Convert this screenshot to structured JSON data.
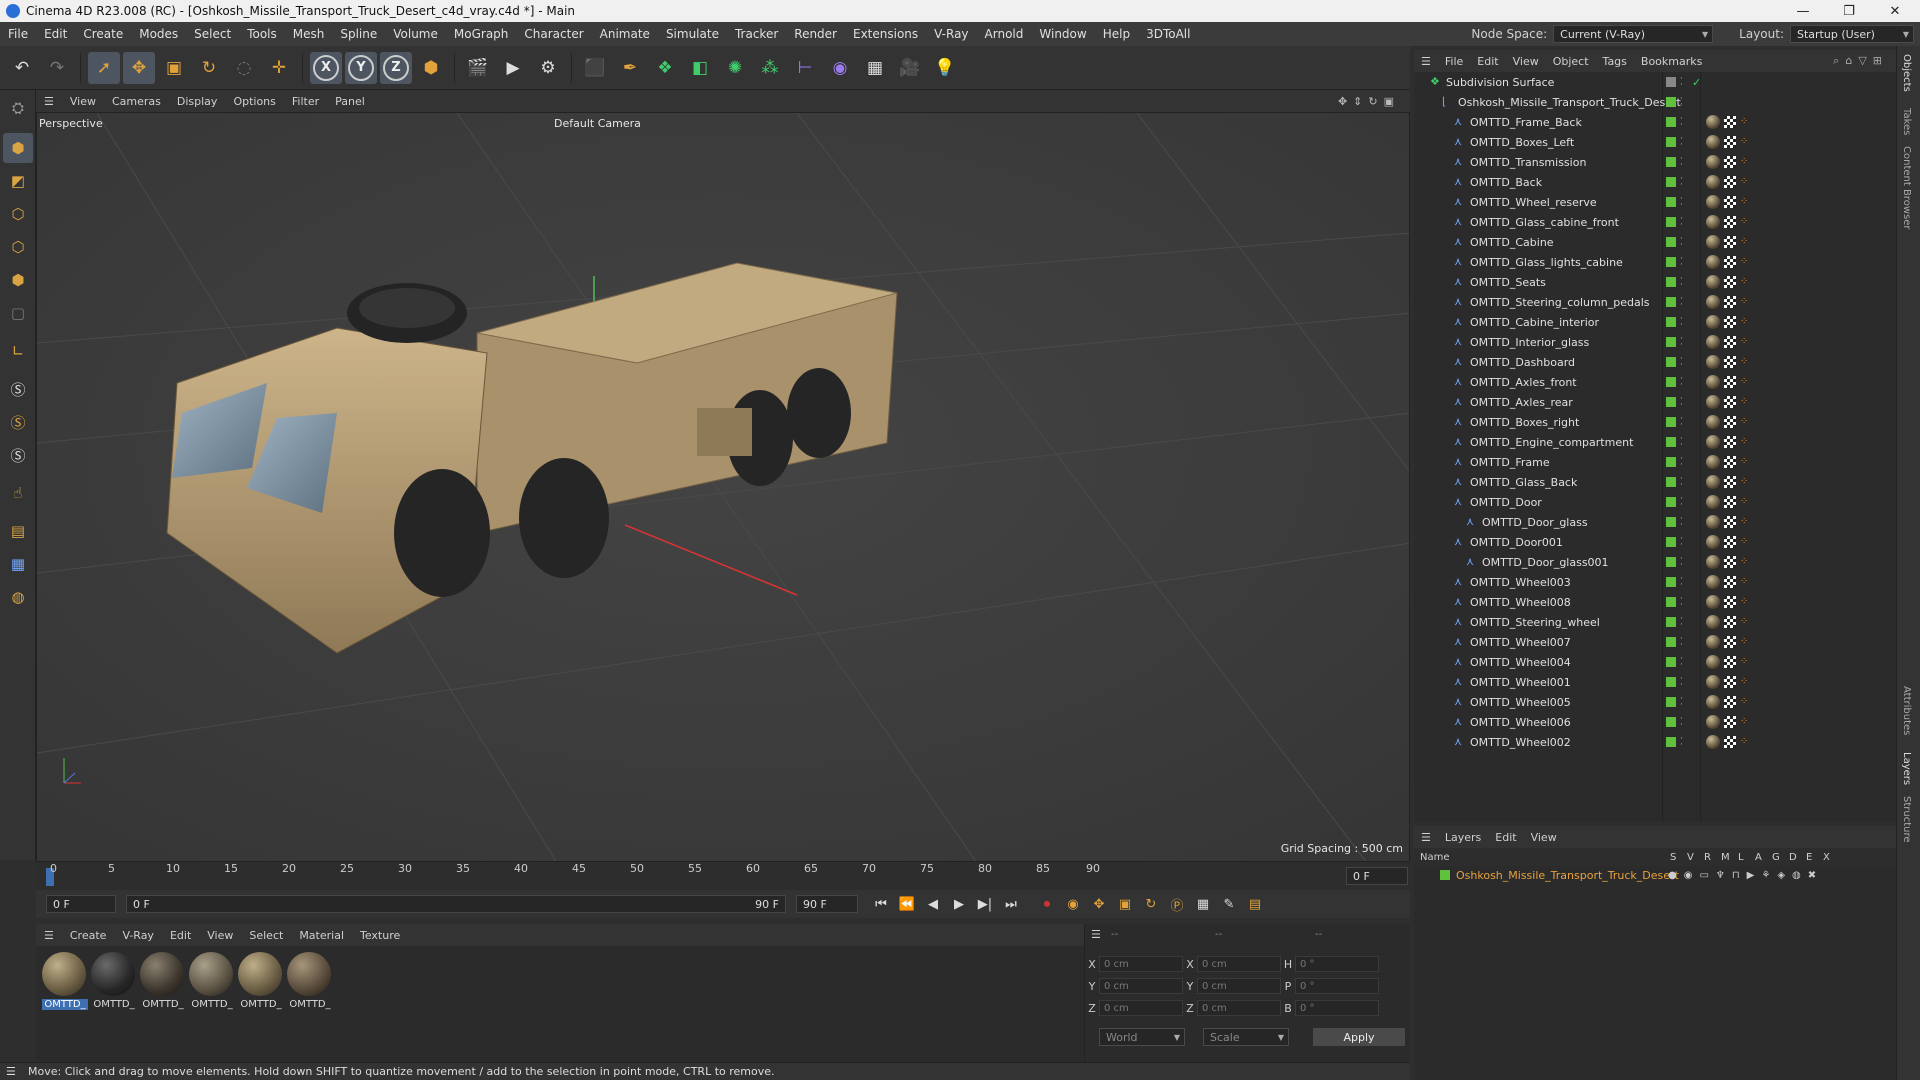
{
  "window": {
    "title": "Cinema 4D R23.008 (RC) - [Oshkosh_Missile_Transport_Truck_Desert_c4d_vray.c4d *] - Main",
    "controls": [
      "—",
      "❐",
      "✕"
    ]
  },
  "menubar": {
    "items": [
      "File",
      "Edit",
      "Create",
      "Modes",
      "Select",
      "Tools",
      "Mesh",
      "Spline",
      "Volume",
      "MoGraph",
      "Character",
      "Animate",
      "Simulate",
      "Tracker",
      "Render",
      "Extensions",
      "V-Ray",
      "Arnold",
      "Window",
      "Help",
      "3DToAll"
    ],
    "node_space_label": "Node Space:",
    "node_space_value": "Current (V-Ray)",
    "layout_label": "Layout:",
    "layout_value": "Startup (User)"
  },
  "viewport": {
    "menu": [
      "View",
      "Cameras",
      "Display",
      "Options",
      "Filter",
      "Panel"
    ],
    "view_name": "Perspective",
    "camera": "Default Camera",
    "grid_spacing": "Grid Spacing : 500 cm"
  },
  "timeline": {
    "ticks": [
      "0",
      "5",
      "10",
      "15",
      "20",
      "25",
      "30",
      "35",
      "40",
      "45",
      "50",
      "55",
      "60",
      "65",
      "70",
      "75",
      "80",
      "85",
      "90"
    ],
    "current_frame_right": "0 F",
    "start_field": "0 F",
    "range_start": "0 F",
    "range_end": "90 F",
    "end_field": "90 F"
  },
  "materials": {
    "menu": [
      "Create",
      "V-Ray",
      "Edit",
      "View",
      "Select",
      "Material",
      "Texture"
    ],
    "items": [
      "OMTTD_",
      "OMTTD_",
      "OMTTD_",
      "OMTTD_",
      "OMTTD_",
      "OMTTD_"
    ]
  },
  "coords": {
    "headers": [
      "--",
      "--",
      "--"
    ],
    "rows": [
      {
        "a": "X",
        "av": "0 cm",
        "b": "X",
        "bv": "0 cm",
        "c": "H",
        "cv": "0 °"
      },
      {
        "a": "Y",
        "av": "0 cm",
        "b": "Y",
        "bv": "0 cm",
        "c": "P",
        "cv": "0 °"
      },
      {
        "a": "Z",
        "av": "0 cm",
        "b": "Z",
        "bv": "0 cm",
        "c": "B",
        "cv": "0 °"
      }
    ],
    "space": "World",
    "mode": "Scale",
    "apply": "Apply"
  },
  "status": "Move: Click and drag to move elements. Hold down SHIFT to quantize movement / add to the selection in point mode, CTRL to remove.",
  "objects": {
    "menu": [
      "File",
      "Edit",
      "View",
      "Object",
      "Tags",
      "Bookmarks"
    ],
    "rows": [
      {
        "name": "Subdivision Surface",
        "level": 0
      },
      {
        "name": "Oshkosh_Missile_Transport_Truck_Desert",
        "level": 1
      },
      {
        "name": "OMTTD_Frame_Back",
        "level": 2
      },
      {
        "name": "OMTTD_Boxes_Left",
        "level": 2
      },
      {
        "name": "OMTTD_Transmission",
        "level": 2
      },
      {
        "name": "OMTTD_Back",
        "level": 2
      },
      {
        "name": "OMTTD_Wheel_reserve",
        "level": 2
      },
      {
        "name": "OMTTD_Glass_cabine_front",
        "level": 2
      },
      {
        "name": "OMTTD_Cabine",
        "level": 2
      },
      {
        "name": "OMTTD_Glass_lights_cabine",
        "level": 2
      },
      {
        "name": "OMTTD_Seats",
        "level": 2
      },
      {
        "name": "OMTTD_Steering_column_pedals",
        "level": 2
      },
      {
        "name": "OMTTD_Cabine_interior",
        "level": 2
      },
      {
        "name": "OMTTD_Interior_glass",
        "level": 2
      },
      {
        "name": "OMTTD_Dashboard",
        "level": 2
      },
      {
        "name": "OMTTD_Axles_front",
        "level": 2
      },
      {
        "name": "OMTTD_Axles_rear",
        "level": 2
      },
      {
        "name": "OMTTD_Boxes_right",
        "level": 2
      },
      {
        "name": "OMTTD_Engine_compartment",
        "level": 2
      },
      {
        "name": "OMTTD_Frame",
        "level": 2
      },
      {
        "name": "OMTTD_Glass_Back",
        "level": 2
      },
      {
        "name": "OMTTD_Door",
        "level": 2
      },
      {
        "name": "OMTTD_Door_glass",
        "level": 3
      },
      {
        "name": "OMTTD_Door001",
        "level": 2
      },
      {
        "name": "OMTTD_Door_glass001",
        "level": 3
      },
      {
        "name": "OMTTD_Wheel003",
        "level": 2
      },
      {
        "name": "OMTTD_Wheel008",
        "level": 2
      },
      {
        "name": "OMTTD_Steering_wheel",
        "level": 2
      },
      {
        "name": "OMTTD_Wheel007",
        "level": 2
      },
      {
        "name": "OMTTD_Wheel004",
        "level": 2
      },
      {
        "name": "OMTTD_Wheel001",
        "level": 2
      },
      {
        "name": "OMTTD_Wheel005",
        "level": 2
      },
      {
        "name": "OMTTD_Wheel006",
        "level": 2
      },
      {
        "name": "OMTTD_Wheel002",
        "level": 2
      }
    ]
  },
  "layers": {
    "menu": [
      "Layers",
      "Edit",
      "View"
    ],
    "header_name": "Name",
    "header_flags": [
      "S",
      "V",
      "R",
      "M",
      "L",
      "A",
      "G",
      "D",
      "E",
      "X"
    ],
    "rows": [
      {
        "name": "Oshkosh_Missile_Transport_Truck_Desert",
        "color": "#5fc13c"
      }
    ]
  },
  "side_tabs": [
    "Objects",
    "Takes",
    "Content Browser",
    "Attributes",
    "Layers",
    "Structure"
  ]
}
